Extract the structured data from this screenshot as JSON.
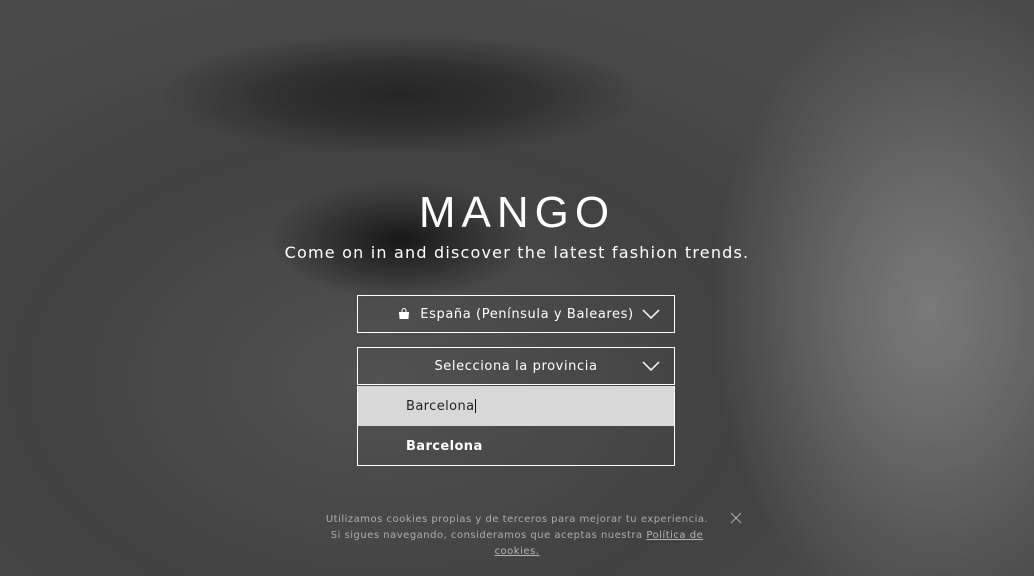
{
  "brand": {
    "logo_text": "MANGO"
  },
  "hero": {
    "tagline": "Come on in and discover the latest fashion trends."
  },
  "country_select": {
    "selected": "España (Península y Baleares)",
    "icon": "shopping-bag-icon"
  },
  "province_select": {
    "placeholder": "Selecciona la provincia",
    "search_value": "Barcelona",
    "options": [
      "Barcelona"
    ]
  },
  "cookie_banner": {
    "line1": "Utilizamos cookies propias y de terceros para mejorar tu experiencia.",
    "line2": "Si sigues navegando, consideramos que aceptas nuestra",
    "link": "Política de cookies."
  }
}
